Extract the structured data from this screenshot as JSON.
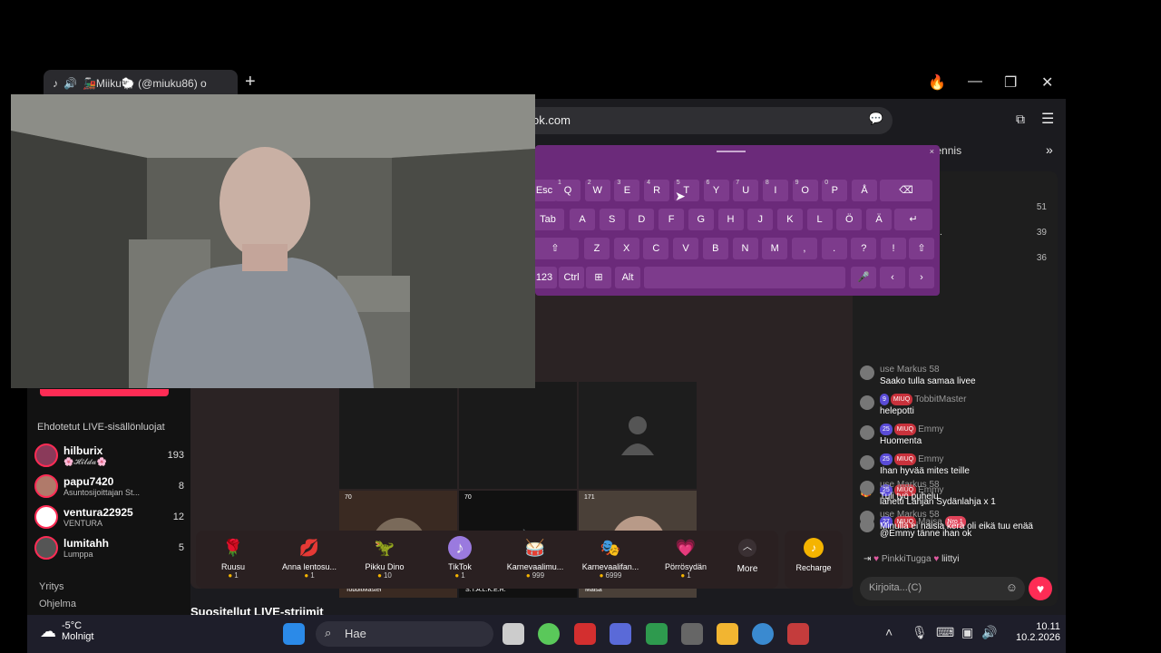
{
  "browser": {
    "tab_title": "🚂Miiku🐑 (@miuku86) o",
    "address": "iktok.com",
    "bookmark_tennis": "Tennis"
  },
  "leftnav": {
    "suggested_title": "Ehdotetut LIVE-sisällönluojat",
    "creators": [
      {
        "name": "hilburix",
        "sub": "🌸𝓗𝓲𝓵𝓭𝓪🌸",
        "count": "193"
      },
      {
        "name": "papu7420",
        "sub": "Asuntosijoittajan St...",
        "count": "8"
      },
      {
        "name": "ventura22925",
        "sub": "VENTURA",
        "count": "12"
      },
      {
        "name": "lumitahh",
        "sub": "Lumppa",
        "count": "5"
      }
    ],
    "link_yritys": "Yritys",
    "link_ohjelma": "Ohjelma"
  },
  "stage": {
    "guests": [
      {
        "badge": "70",
        "label": "TobbitMaster"
      },
      {
        "badge": "70",
        "label": "S.T.A.L.K.E.R."
      },
      {
        "badge": "171",
        "label": "Maisa"
      }
    ],
    "suositellut": "Suositellut LIVE-striimit"
  },
  "gifts": [
    {
      "name": "Ruusu",
      "price": "1",
      "icon": "🌹"
    },
    {
      "name": "Anna lentosu...",
      "price": "1",
      "icon": "💋"
    },
    {
      "name": "Pikku Dino",
      "price": "10",
      "icon": "🦖"
    },
    {
      "name": "TikTok",
      "price": "1",
      "icon": "♪"
    },
    {
      "name": "Karnevaalimu...",
      "price": "999",
      "icon": "🥁"
    },
    {
      "name": "Karnevaalifan...",
      "price": "6999",
      "icon": "🎭"
    },
    {
      "name": "Pörrösydän",
      "price": "1",
      "icon": "💗"
    }
  ],
  "gifts_more": "More",
  "recharge": "Recharge",
  "chat": {
    "ranks": [
      {
        "name": "",
        "num": "51"
      },
      {
        "name": ".R.",
        "num": "39"
      },
      {
        "name": "",
        "num": "36"
      }
    ],
    "messages": [
      {
        "user": "use Markus 58",
        "pills": [],
        "text": "Saako tulla samaa livee"
      },
      {
        "user": "TobbitMaster",
        "pills": [
          "9",
          "MIUQ"
        ],
        "text": "helepotti"
      },
      {
        "user": "Emmy",
        "pills": [
          "25",
          "MIUQ"
        ],
        "text": "Huomenta"
      },
      {
        "user": "Emmy",
        "pills": [
          "25",
          "MIUQ"
        ],
        "text": "Ihan hyvää mites teille"
      },
      {
        "user": "Emmy",
        "pills": [
          "25",
          "MIUQ"
        ],
        "text": "lähetti Lahjan Sydänlahja x 1"
      },
      {
        "user": "Maisa",
        "pills": [
          "27",
          "MIUQ",
          "Nro 1"
        ],
        "text": "@Emmy tänne ihan ok"
      },
      {
        "user": "use Markus 58",
        "pills": [],
        "text": "Tuli työ puhelu"
      },
      {
        "user": "use Markus 58",
        "pills": [],
        "text": "Minulla ei naisia kera oli eikä tuu enää"
      }
    ],
    "joined_user": "PinkkiTugga",
    "joined_text": "liittyi",
    "input_placeholder": "Kirjoita...(C)"
  },
  "keyboard": {
    "row1": [
      "Esc",
      "Q",
      "W",
      "E",
      "R",
      "T",
      "Y",
      "U",
      "I",
      "O",
      "P",
      "Å",
      "⌫"
    ],
    "row1_nums": [
      "",
      "1",
      "2",
      "3",
      "4",
      "5",
      "6",
      "7",
      "8",
      "9",
      "0",
      "",
      ""
    ],
    "row2": [
      "Tab",
      "A",
      "S",
      "D",
      "F",
      "G",
      "H",
      "J",
      "K",
      "L",
      "Ö",
      "Ä",
      "↵"
    ],
    "row3": [
      "⇧",
      "Z",
      "X",
      "C",
      "V",
      "B",
      "N",
      "M",
      ",",
      ".",
      "?",
      "!",
      "⇧"
    ],
    "row4_left": [
      "123",
      "Ctrl",
      "⊞",
      "Alt"
    ],
    "row4_right": [
      "🎤",
      "‹",
      "›"
    ]
  },
  "taskbar": {
    "temp": "-5°C",
    "weather": "Molnigt",
    "search": "Hae",
    "time": "10.11",
    "date": "10.2.2026"
  }
}
